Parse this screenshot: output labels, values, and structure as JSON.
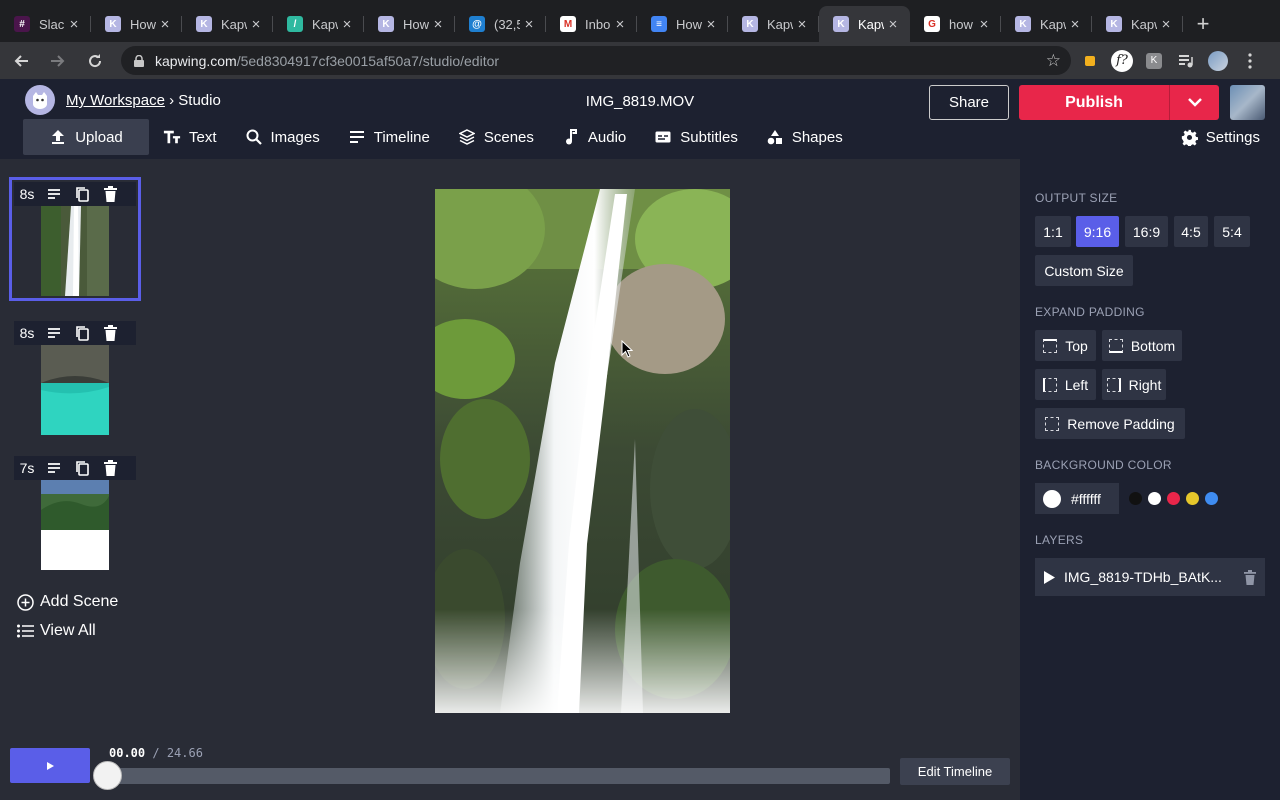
{
  "browser": {
    "tabs": [
      {
        "title": "Slack",
        "color": "#4a154b",
        "glyph": "#"
      },
      {
        "title": "How",
        "color": "#b5b6e3",
        "glyph": "K"
      },
      {
        "title": "Kapw",
        "color": "#b5b6e3",
        "glyph": "K"
      },
      {
        "title": "Kapw",
        "color": "#2fb9a0",
        "glyph": "/"
      },
      {
        "title": "How",
        "color": "#b5b6e3",
        "glyph": "K"
      },
      {
        "title": "(32,5",
        "color": "#1f7fd0",
        "glyph": "@"
      },
      {
        "title": "Inbo",
        "color": "#ffffff",
        "glyph": "M"
      },
      {
        "title": "How",
        "color": "#4285f4",
        "glyph": "≡"
      },
      {
        "title": "Kapw",
        "color": "#b5b6e3",
        "glyph": "K"
      },
      {
        "title": "Kapw",
        "color": "#b5b6e3",
        "glyph": "K",
        "active": true
      },
      {
        "title": "how",
        "color": "#ffffff",
        "glyph": "G"
      },
      {
        "title": "Kapw",
        "color": "#b5b6e3",
        "glyph": "K"
      },
      {
        "title": "Kapw",
        "color": "#b5b6e3",
        "glyph": "K"
      }
    ],
    "url_host": "kapwing.com",
    "url_path": "/5ed8304917cf3e0015af50a7/studio/editor"
  },
  "header": {
    "workspace": "My Workspace",
    "separator": " › ",
    "studio": "Studio",
    "filename": "IMG_8819.MOV",
    "share_label": "Share",
    "publish_label": "Publish"
  },
  "toolbar": {
    "upload": "Upload",
    "text": "Text",
    "images": "Images",
    "timeline": "Timeline",
    "scenes": "Scenes",
    "audio": "Audio",
    "subtitles": "Subtitles",
    "shapes": "Shapes",
    "settings": "Settings"
  },
  "scenes": {
    "items": [
      {
        "duration": "8s"
      },
      {
        "duration": "8s"
      },
      {
        "duration": "7s"
      }
    ],
    "add_scene": "Add Scene",
    "view_all": "View All"
  },
  "panel": {
    "output_size_label": "OUTPUT SIZE",
    "sizes": [
      "1:1",
      "9:16",
      "16:9",
      "4:5",
      "5:4"
    ],
    "selected_size": "9:16",
    "custom_size": "Custom Size",
    "expand_padding_label": "EXPAND PADDING",
    "padding": {
      "top": "Top",
      "bottom": "Bottom",
      "left": "Left",
      "right": "Right",
      "remove": "Remove Padding"
    },
    "background_color_label": "BACKGROUND COLOR",
    "background_color": "#ffffff",
    "swatches": [
      "#111111",
      "#ffffff",
      "#e8264a",
      "#e6c72b",
      "#3f8cf0"
    ],
    "layers_label": "LAYERS",
    "layer_name": "IMG_8819-TDHb_BAtK..."
  },
  "playback": {
    "current_time": "00.00",
    "divider": " / ",
    "total_time": "24.66",
    "progress": 0,
    "edit_timeline": "Edit Timeline"
  }
}
